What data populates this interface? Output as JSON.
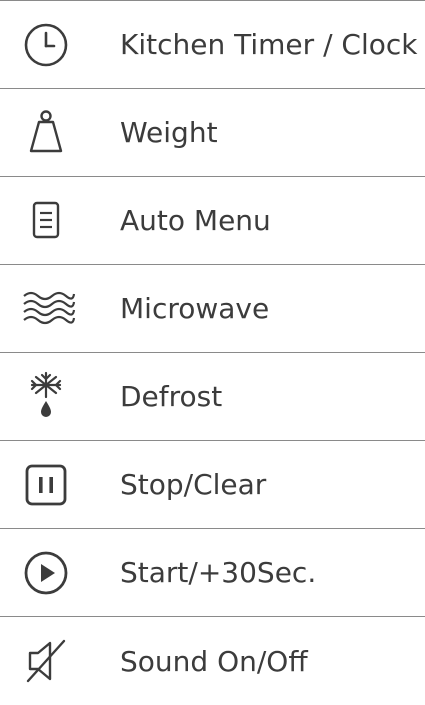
{
  "controls": {
    "items": [
      {
        "icon": "clock-icon",
        "label": "Kitchen Timer / Clock"
      },
      {
        "icon": "weight-icon",
        "label": "Weight"
      },
      {
        "icon": "menu-document-icon",
        "label": "Auto Menu"
      },
      {
        "icon": "microwave-waves-icon",
        "label": "Microwave"
      },
      {
        "icon": "snowflake-droplet-icon",
        "label": "Defrost"
      },
      {
        "icon": "pause-icon",
        "label": "Stop/Clear"
      },
      {
        "icon": "play-icon",
        "label": "Start/+30Sec."
      },
      {
        "icon": "speaker-mute-icon",
        "label": "Sound On/Off"
      }
    ]
  },
  "colors": {
    "text": "#3c3c3c",
    "divider": "#8a8a8a",
    "background": "#ffffff"
  }
}
